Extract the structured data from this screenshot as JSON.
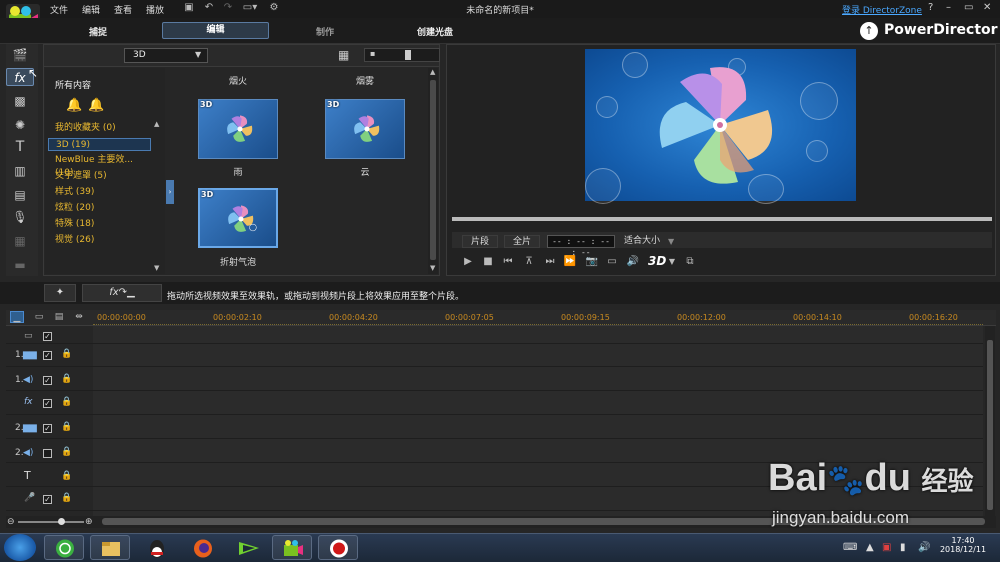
{
  "menu": {
    "file": "文件",
    "edit": "编辑",
    "view": "查看",
    "play": "播放"
  },
  "window": {
    "title": "未命名的新项目*",
    "login": "登录 DirectorZone",
    "help": "?",
    "minimize": "–",
    "maximize": "▭",
    "close": "✕"
  },
  "modes": {
    "capture": "捕捉",
    "edit": "编辑",
    "produce": "制作",
    "disc": "创建光盘"
  },
  "brand": "PowerDirector",
  "library": {
    "category": "3D",
    "tree_header": "所有内容",
    "tree_items": [
      {
        "label": "我的收藏夹  (0)"
      },
      {
        "label": "3D  (19)"
      },
      {
        "label": "NewBlue 主要效...  (10)"
      },
      {
        "label": "文字遮罩  (5)"
      },
      {
        "label": "样式  (39)"
      },
      {
        "label": "炫粒  (20)"
      },
      {
        "label": "特殊  (18)"
      },
      {
        "label": "视觉  (26)"
      }
    ],
    "thumbs_top": [
      "烟火",
      "烟雾"
    ],
    "thumbs": [
      {
        "label": "雨",
        "badge": "3D"
      },
      {
        "label": "云",
        "badge": "3D"
      },
      {
        "label": "折射气泡",
        "badge": "3D"
      }
    ]
  },
  "preview": {
    "clip": "片段",
    "full": "全片",
    "timecode": "-- : -- : -- : --",
    "fit": "适合大小",
    "stereo": "3D"
  },
  "hint": "拖动所选视频效果至效果轨，或拖动到视频片段上将效果应用至整个片段。",
  "timeline": {
    "ruler": [
      "00:00:00:00",
      "00:00:02:10",
      "00:00:04:20",
      "00:00:07:05",
      "00:00:09:15",
      "00:00:12:00",
      "00:00:14:10",
      "00:00:16:20"
    ],
    "tracks": [
      {
        "num": "",
        "icon": "▭",
        "checked": true,
        "lock": ""
      },
      {
        "num": "1.",
        "icon": "▆▆",
        "checked": true,
        "lock": "🔒"
      },
      {
        "num": "1.",
        "icon": "◀)",
        "checked": true,
        "lock": "🔒"
      },
      {
        "num": "",
        "icon": "fx",
        "checked": true,
        "lock": "🔒"
      },
      {
        "num": "2.",
        "icon": "▆▆",
        "checked": true,
        "lock": "🔒"
      },
      {
        "num": "2.",
        "icon": "◀)",
        "checked": false,
        "lock": "🔒"
      },
      {
        "num": "",
        "icon": "T",
        "checked": null,
        "lock": "🔒"
      },
      {
        "num": "",
        "icon": "🎤",
        "checked": true,
        "lock": "🔒"
      }
    ]
  },
  "taskbar": {
    "time": "17:40",
    "date": "2018/12/11"
  },
  "watermark": {
    "brand": "Bai",
    "brand2": "du",
    "cn": "经验",
    "url": "jingyan.baidu.com"
  },
  "colors": {
    "accent": "#4a7ab0",
    "folder_text": "#e8b830",
    "ruler": "#c88a20"
  }
}
